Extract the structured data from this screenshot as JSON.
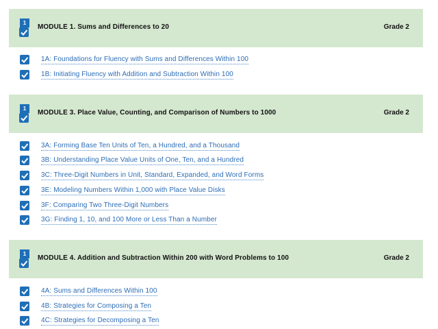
{
  "modules": [
    {
      "number": "1",
      "title": "MODULE 1. Sums and Differences to 20",
      "grade": "Grade 2",
      "lessons": [
        "1A: Foundations for Fluency with Sums and Differences Within 100",
        "1B: Initiating Fluency with Addition and Subtraction Within 100"
      ]
    },
    {
      "number": "1",
      "title": "MODULE 3. Place Value, Counting, and Comparison of Numbers to 1000",
      "grade": "Grade 2",
      "lessons": [
        "3A: Forming Base Ten Units of Ten, a Hundred, and a Thousand",
        "3B: Understanding Place Value Units of One, Ten, and a Hundred",
        "3C: Three-Digit Numbers in Unit, Standard, Expanded, and Word Forms",
        "3E: Modeling Numbers Within 1,000 with Place Value Disks",
        "3F: Comparing Two Three-Digit Numbers",
        "3G: Finding 1, 10, and 100 More or Less Than a Number"
      ]
    },
    {
      "number": "1",
      "title": "MODULE 4. Addition and Subtraction Within 200 with Word Problems to 100",
      "grade": "Grade 2",
      "lessons": [
        "4A: Sums and Differences Within 100",
        "4B: Strategies for Composing a Ten",
        "4C: Strategies for Decomposing a Ten"
      ]
    }
  ],
  "colors": {
    "header_bg": "#d4e7cf",
    "accent": "#1f6fb7",
    "link": "#2b6cb5"
  },
  "icons": {
    "module_checkbox": "checkbox-checked-icon",
    "lesson_checkbox": "checkbox-checked-icon"
  }
}
